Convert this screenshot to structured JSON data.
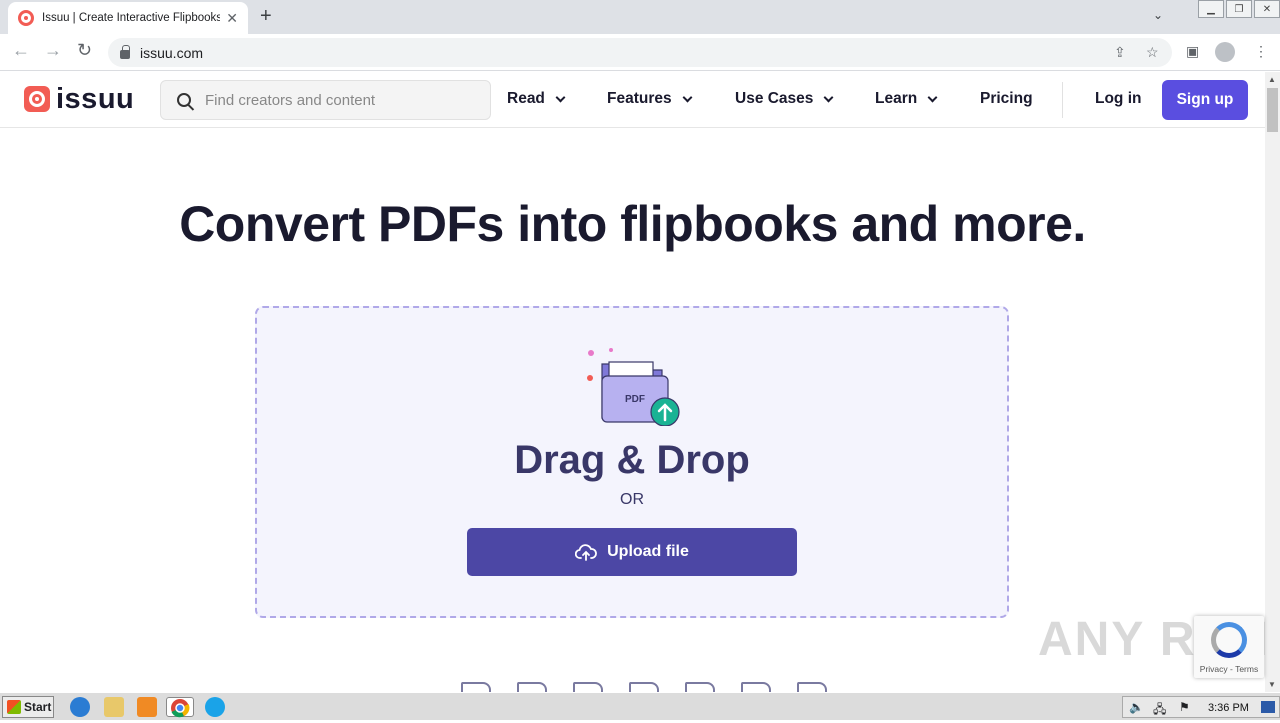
{
  "browser": {
    "tab_title": "Issuu | Create Interactive Flipbooks",
    "tab_close": "✕",
    "new_tab": "+",
    "url": "issuu.com"
  },
  "header": {
    "logo_text": "issuu",
    "search_placeholder": "Find creators and content",
    "nav": [
      {
        "label": "Read"
      },
      {
        "label": "Features"
      },
      {
        "label": "Use Cases"
      },
      {
        "label": "Learn"
      },
      {
        "label": "Pricing"
      }
    ],
    "login": "Log in",
    "signup": "Sign up"
  },
  "main": {
    "headline": "Convert PDFs into flipbooks and more.",
    "dropzone": {
      "title": "Drag & Drop",
      "or": "OR",
      "upload_label": "Upload file",
      "icon_label": "PDF"
    }
  },
  "overlay": {
    "watermark": "ANY RUN",
    "recaptcha": "Privacy - Terms"
  },
  "taskbar": {
    "start": "Start",
    "clock": "3:36 PM"
  },
  "colors": {
    "brand": "#f25c54",
    "primary": "#5a4ee0",
    "upload": "#4c47a5",
    "dropzone_bg": "#f4f4fd"
  }
}
